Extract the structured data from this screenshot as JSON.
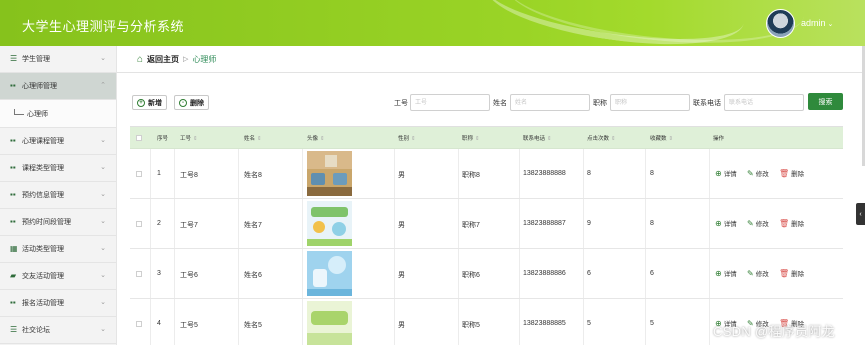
{
  "header": {
    "title": "大学生心理测评与分析系统",
    "user": "admin",
    "caret": "⌄"
  },
  "sidebar": {
    "items": [
      {
        "label": "学生管理",
        "icon": "list-icon"
      },
      {
        "label": "心理师管理",
        "icon": "grid-icon",
        "active": true
      },
      {
        "label": "心理课程管理",
        "icon": "grid-icon"
      },
      {
        "label": "课程类型管理",
        "icon": "grid-icon"
      },
      {
        "label": "预约信息管理",
        "icon": "grid-icon"
      },
      {
        "label": "预约时间段管理",
        "icon": "grid-icon"
      },
      {
        "label": "活动类型管理",
        "icon": "table-icon"
      },
      {
        "label": "交友活动管理",
        "icon": "thumb-icon"
      },
      {
        "label": "报名活动管理",
        "icon": "grid-icon"
      },
      {
        "label": "社交论坛",
        "icon": "list-icon"
      }
    ],
    "sub_item": "心理师",
    "chevron": "⌄"
  },
  "breadcrumb": {
    "home": "返回主页",
    "sep": "▷",
    "current": "心理师"
  },
  "toolbar": {
    "add_label": "新增",
    "delete_label": "删除",
    "add_icon": "+",
    "delete_icon": "-"
  },
  "search": {
    "fields": [
      {
        "label": "工号",
        "placeholder": "工号"
      },
      {
        "label": "姓名",
        "placeholder": "姓名"
      },
      {
        "label": "职称",
        "placeholder": "职称"
      },
      {
        "label": "联系电话",
        "placeholder": "联系电话"
      }
    ],
    "button": "搜索"
  },
  "table": {
    "columns": [
      "序号",
      "工号",
      "姓名",
      "头像",
      "性别",
      "职称",
      "联系电话",
      "点击次数",
      "收藏数",
      "操作"
    ],
    "sort_glyph": "⇕",
    "rows": [
      {
        "index": "1",
        "id": "工号8",
        "name": "姓名8",
        "gender": "男",
        "title": "职称8",
        "phone": "13823888888",
        "clicks": "8",
        "favorites": "8"
      },
      {
        "index": "2",
        "id": "工号7",
        "name": "姓名7",
        "gender": "男",
        "title": "职称7",
        "phone": "13823888887",
        "clicks": "9",
        "favorites": "8"
      },
      {
        "index": "3",
        "id": "工号6",
        "name": "姓名6",
        "gender": "男",
        "title": "职称6",
        "phone": "13823888886",
        "clicks": "6",
        "favorites": "6"
      },
      {
        "index": "4",
        "id": "工号5",
        "name": "姓名5",
        "gender": "男",
        "title": "职称5",
        "phone": "13823888885",
        "clicks": "5",
        "favorites": "5"
      }
    ],
    "actions": {
      "detail": "详情",
      "edit": "修改",
      "delete": "删除"
    }
  },
  "watermark": "CSDN @程序员阿龙",
  "side_tab": "‹"
}
